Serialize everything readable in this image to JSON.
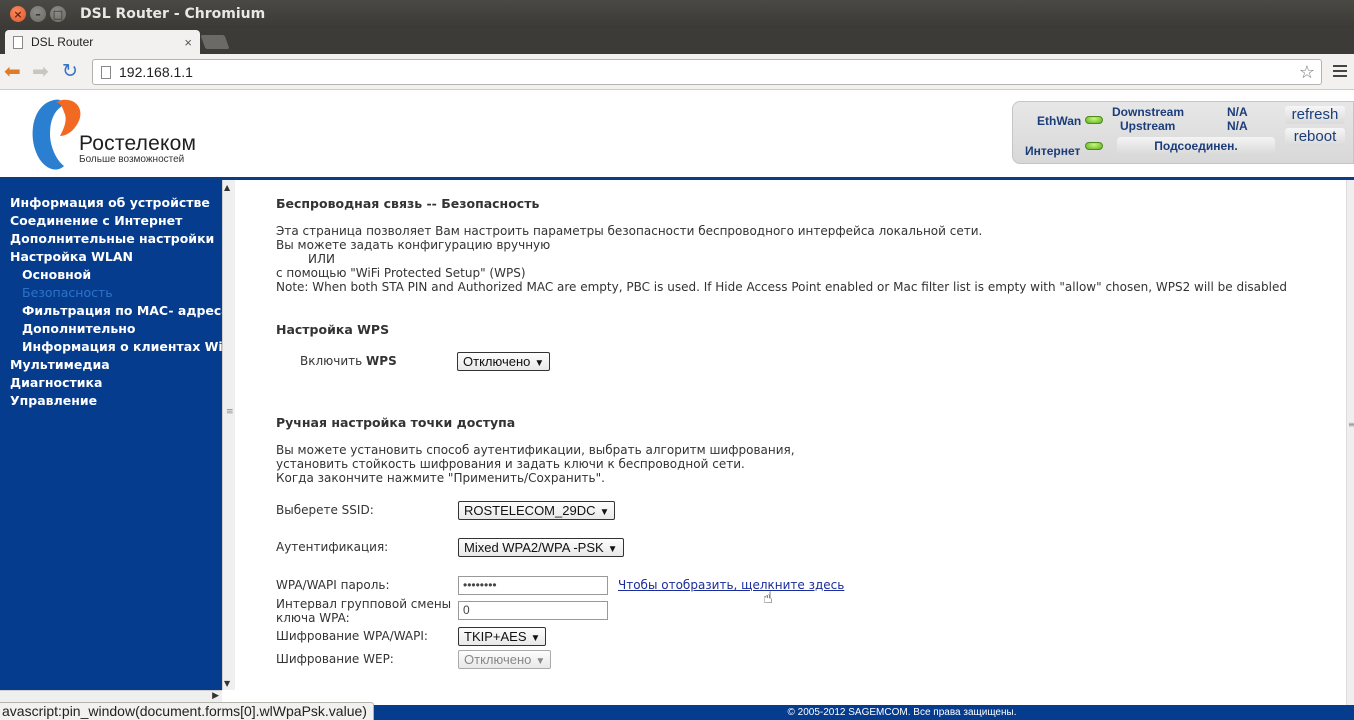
{
  "window": {
    "title": "DSL Router - Chromium"
  },
  "tab": {
    "label": "DSL Router",
    "close": "×"
  },
  "toolbar": {
    "url": "192.168.1.1"
  },
  "header": {
    "brand": "Ростелеком",
    "slogan": "Больше возможностей",
    "status": {
      "ethwan": "EthWan",
      "downstream": "Downstream",
      "upstream": "Upstream",
      "downstream_value": "N/A",
      "upstream_value": "N/A",
      "internet": "Интернет",
      "connection": "Подсоединен.",
      "refresh": "refresh",
      "reboot": "reboot"
    }
  },
  "sidebar": {
    "items": [
      {
        "label": "Информация об устройстве"
      },
      {
        "label": "Соединение с Интернет"
      },
      {
        "label": "Дополнительные настройки"
      },
      {
        "label": "Настройка WLAN"
      },
      {
        "label": "Основной"
      },
      {
        "label": "Безопасность"
      },
      {
        "label": "Фильтрация по MAC- адресам"
      },
      {
        "label": "Дополнительно"
      },
      {
        "label": "Информация о клиентах WiFi"
      },
      {
        "label": "Мультимедиа"
      },
      {
        "label": "Диагностика"
      },
      {
        "label": "Управление"
      }
    ]
  },
  "main": {
    "title": "Беспроводная связь -- Безопасность",
    "intro1": "Эта страница позволяет Вам настроить параметры безопасности беспроводного интерфейса локальной сети.",
    "intro2": "Вы можете задать конфигурацию вручную",
    "intro3": "ИЛИ",
    "intro4": "с помощью \"WiFi Protected Setup\" (WPS)",
    "note": "Note: When both STA PIN and Authorized MAC are empty, PBC is used. If Hide Access Point enabled or Mac filter list is empty with \"allow\" chosen, WPS2 will be disabled",
    "wps_title": "Настройка WPS",
    "wps_enable_prefix": "Включить",
    "wps_enable_bold": "WPS",
    "wps_value": "Отключено",
    "manual_title": "Ручная настройка точки доступа",
    "manual1": "Вы можете установить способ аутентификации, выбрать алгоритм шифрования,",
    "manual2": "установить стойкость шифрования и задать ключи к беспроводной сети.",
    "manual3": "Когда закончите нажмите \"Применить/Сохранить\".",
    "ssid_label": "Выберете SSID:",
    "ssid_value": "ROSTELECOM_29DC",
    "auth_label": "Аутентификация:",
    "auth_value": "Mixed WPA2/WPA -PSK",
    "pass_label": "WPA/WAPI пароль:",
    "pass_value": "••••••••",
    "pass_link": "Чтобы отобразить, щелкните здесь",
    "interval_label1": "Интервал групповой смены",
    "interval_label2": "ключа WPA:",
    "interval_value": "0",
    "enc_label": "Шифрование WPA/WAPI:",
    "enc_value": "TKIP+AES",
    "wep_label": "Шифрование WEP:",
    "wep_value": "Отключено"
  },
  "footer": {
    "copyright": "© 2005-2012 SAGEMCOM. Все права защищены."
  },
  "statusbar": {
    "text": "avascript:pin_window(document.forms[0].wlWpaPsk.value)"
  }
}
